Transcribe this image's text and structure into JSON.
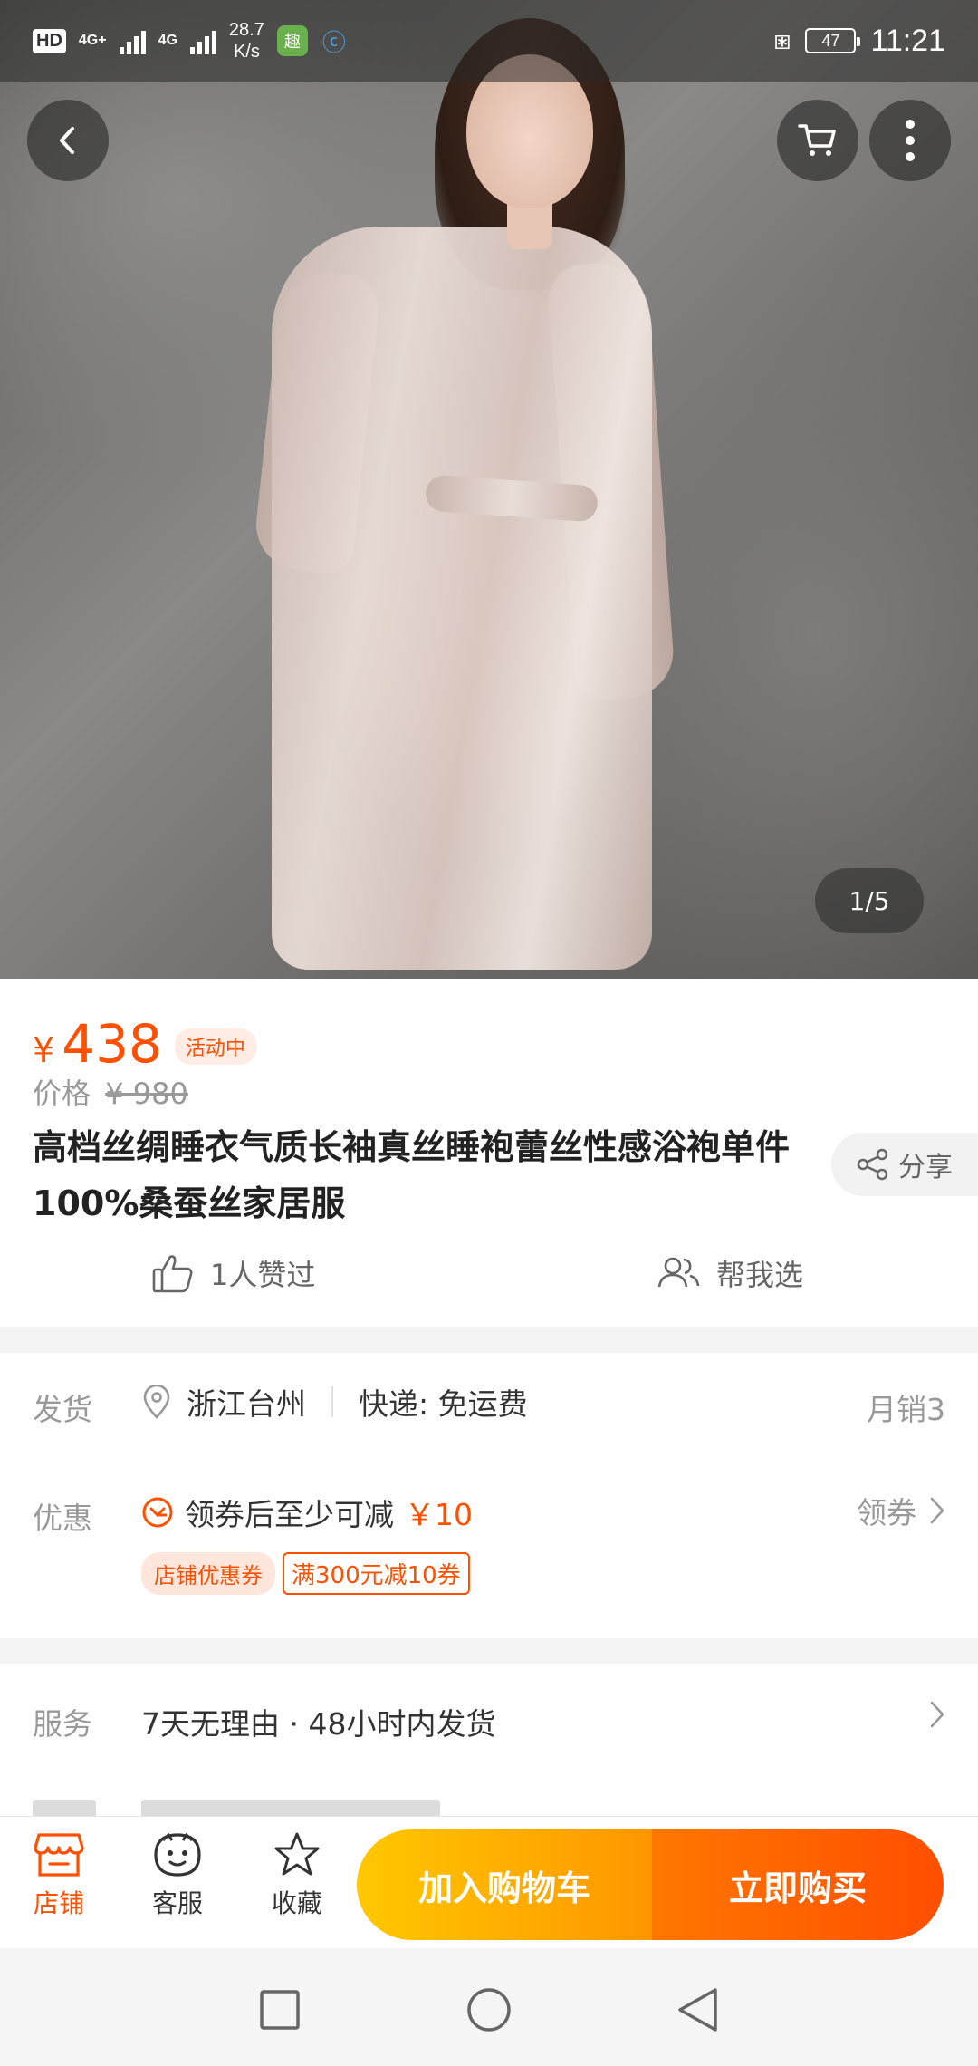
{
  "status_bar": {
    "hd": "HD",
    "net1": "4G+",
    "net2": "4G",
    "speed_value": "28.7",
    "speed_unit": "K/s",
    "app_icon_1": "趣",
    "battery": "47",
    "time": "11:21",
    "icons": [
      "vibrate-icon",
      "battery-icon",
      "signal-icon"
    ]
  },
  "hero": {
    "page_indicator": "1/5",
    "buttons": [
      "back-icon",
      "cart-icon",
      "more-icon"
    ]
  },
  "product": {
    "currency": "¥",
    "price": "438",
    "promo_tag": "活动中",
    "original_label": "价格",
    "original_price": "¥ 980",
    "title": "高档丝绸睡衣气质长袖真丝睡袍蕾丝性感浴袍单件100%桑蚕丝家居服",
    "share_label": "分享",
    "likes_label": "1人赞过",
    "help_label": "帮我选"
  },
  "shipping": {
    "label": "发货",
    "location": "浙江台州",
    "express": "快递: 免运费",
    "monthly_sales": "月销3"
  },
  "coupon": {
    "label": "优惠",
    "text": "领券后至少可减",
    "amount": "￥10",
    "get_label": "领券",
    "store_tag": "店铺优惠券",
    "rule_tag": "满300元减10券"
  },
  "service": {
    "label": "服务",
    "text": "7天无理由 · 48小时内发货"
  },
  "action_bar": {
    "store_label": "店铺",
    "cs_label": "客服",
    "fav_label": "收藏",
    "cart_button": "加入购物车",
    "buy_button": "立即购买"
  },
  "colors": {
    "accent": "#ff5000",
    "cart_gradient": [
      "#ffc800",
      "#ff9600"
    ],
    "buy_gradient": [
      "#ff7700",
      "#ff4e00"
    ]
  }
}
